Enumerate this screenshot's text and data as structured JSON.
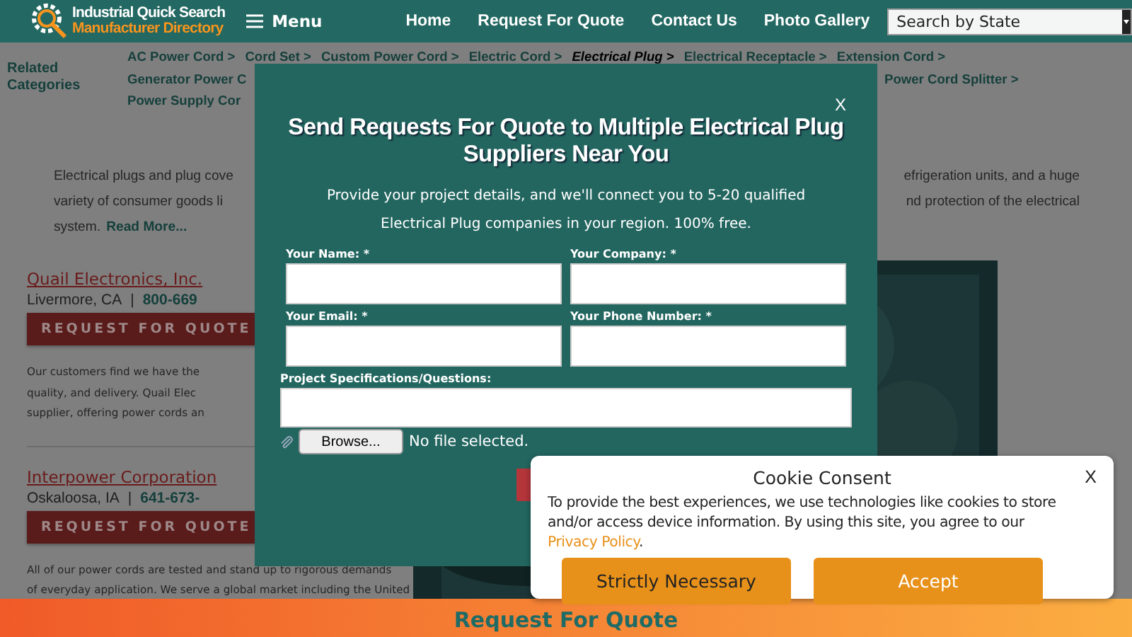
{
  "header": {
    "logo_line1": "Industrial Quick Search",
    "logo_line2": "Manufacturer Directory",
    "menu_label": "Menu",
    "nav": [
      "Home",
      "Request For Quote",
      "Contact Us",
      "Photo Gallery"
    ],
    "state_select": {
      "value": "Search by State"
    }
  },
  "related": {
    "title": "Related Categories",
    "rows": [
      {
        "left": [
          {
            "label": "AC Power Cord >",
            "selected": false
          },
          {
            "label": "Cord Set >",
            "selected": false
          },
          {
            "label": "Custom Power Cord >",
            "selected": false
          },
          {
            "label": "Electric Cord >",
            "selected": false
          },
          {
            "label": "Electrical Plug >",
            "selected": true
          },
          {
            "label": "Electrical Receptacle >",
            "selected": false
          },
          {
            "label": "Extension Cord >",
            "selected": false
          }
        ],
        "right": []
      },
      {
        "left": [
          {
            "label": "Generator Power C",
            "selected": false
          }
        ],
        "right": [
          {
            "label": "Power Cord Splitter >",
            "selected": false
          }
        ]
      },
      {
        "left": [
          {
            "label": "Power Supply Cor",
            "selected": false
          }
        ],
        "right": []
      }
    ]
  },
  "intro": [
    {
      "left": "Electrical plugs and plug cove",
      "right": "efrigeration units, and a huge"
    },
    {
      "left": "variety of consumer goods li",
      "right": "nd protection of the electrical"
    },
    {
      "left": "system.",
      "link": "Read More..."
    }
  ],
  "suppliers": [
    {
      "name": "Quail Electronics, Inc.",
      "city": "Livermore, CA",
      "separator": "|",
      "phone": "800-669",
      "button": "REQUEST FOR QUOTE",
      "desc_lines": [
        "Our customers find we have the",
        "quality, and delivery. Quail Elec",
        "supplier, offering power cords an"
      ]
    },
    {
      "name": "Interpower Corporation",
      "city": "Oskaloosa, IA",
      "separator": "|",
      "phone": "641-673-",
      "button": "REQUEST FOR QUOTE",
      "desc_lines": [
        "All of our power cords are tested and stand up to rigorous demands",
        "of everyday application. We serve a global market including the United"
      ]
    }
  ],
  "modal": {
    "close": "X",
    "title": "Send Requests For Quote to Multiple Electrical Plug Suppliers Near You",
    "description": "Provide your project details, and we'll connect you to 5-20 qualified Electrical Plug companies in your region. 100% free.",
    "fields": [
      {
        "label": "Your Name: *"
      },
      {
        "label": "Your Company: *"
      },
      {
        "label": "Your Email: *"
      },
      {
        "label": "Your Phone Number: *"
      }
    ],
    "specs_label": "Project Specifications/Questions:",
    "browse": "Browse...",
    "file_status": "No file selected."
  },
  "cookie": {
    "title": "Cookie Consent",
    "close": "X",
    "text": "To provide the best experiences, we use technologies like cookies to store and/or access device information. By using this site, you agree to our",
    "link": "Privacy Policy",
    "text_end": ".",
    "buttons": [
      {
        "label": "Strictly Necessary",
        "kind": "secondary"
      },
      {
        "label": "Accept",
        "kind": "primary"
      }
    ]
  },
  "footer_bar": {
    "label": "Request For Quote"
  }
}
